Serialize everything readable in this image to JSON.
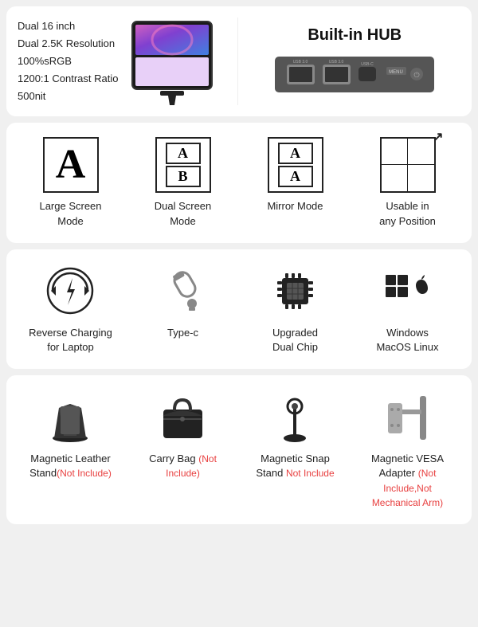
{
  "card1": {
    "specs": [
      "Dual 16 inch",
      "Dual 2.5K Resolution",
      "100%sRGB",
      "1200:1 Contrast Ratio",
      "500nit"
    ],
    "hub_title": "Built-in HUB"
  },
  "card2": {
    "modes": [
      {
        "label": "Large Screen Mode",
        "type": "large"
      },
      {
        "label": "Dual Screen Mode",
        "type": "dual"
      },
      {
        "label": "Mirror Mode",
        "type": "mirror"
      },
      {
        "label": "Usable in any Position",
        "type": "position"
      }
    ]
  },
  "card3": {
    "features": [
      {
        "label": "Reverse Charging for Laptop",
        "type": "reverse"
      },
      {
        "label": "Type-c",
        "type": "typec"
      },
      {
        "label": "Upgraded Dual Chip",
        "type": "chip"
      },
      {
        "label": "Windows MacOS Linux",
        "type": "os"
      }
    ]
  },
  "card4": {
    "accessories": [
      {
        "label": "Magnetic Leather Stand",
        "note": "(Not Include)",
        "type": "stand"
      },
      {
        "label": "Carry Bag",
        "note": "(Not Include)",
        "type": "bag"
      },
      {
        "label": "Magnetic Snap Stand",
        "note": "Not Include",
        "type": "snapstand"
      },
      {
        "label": "Magnetic VESA Adapter",
        "note": "(Not Include,Not Mechanical Arm)",
        "type": "vesa"
      }
    ]
  }
}
